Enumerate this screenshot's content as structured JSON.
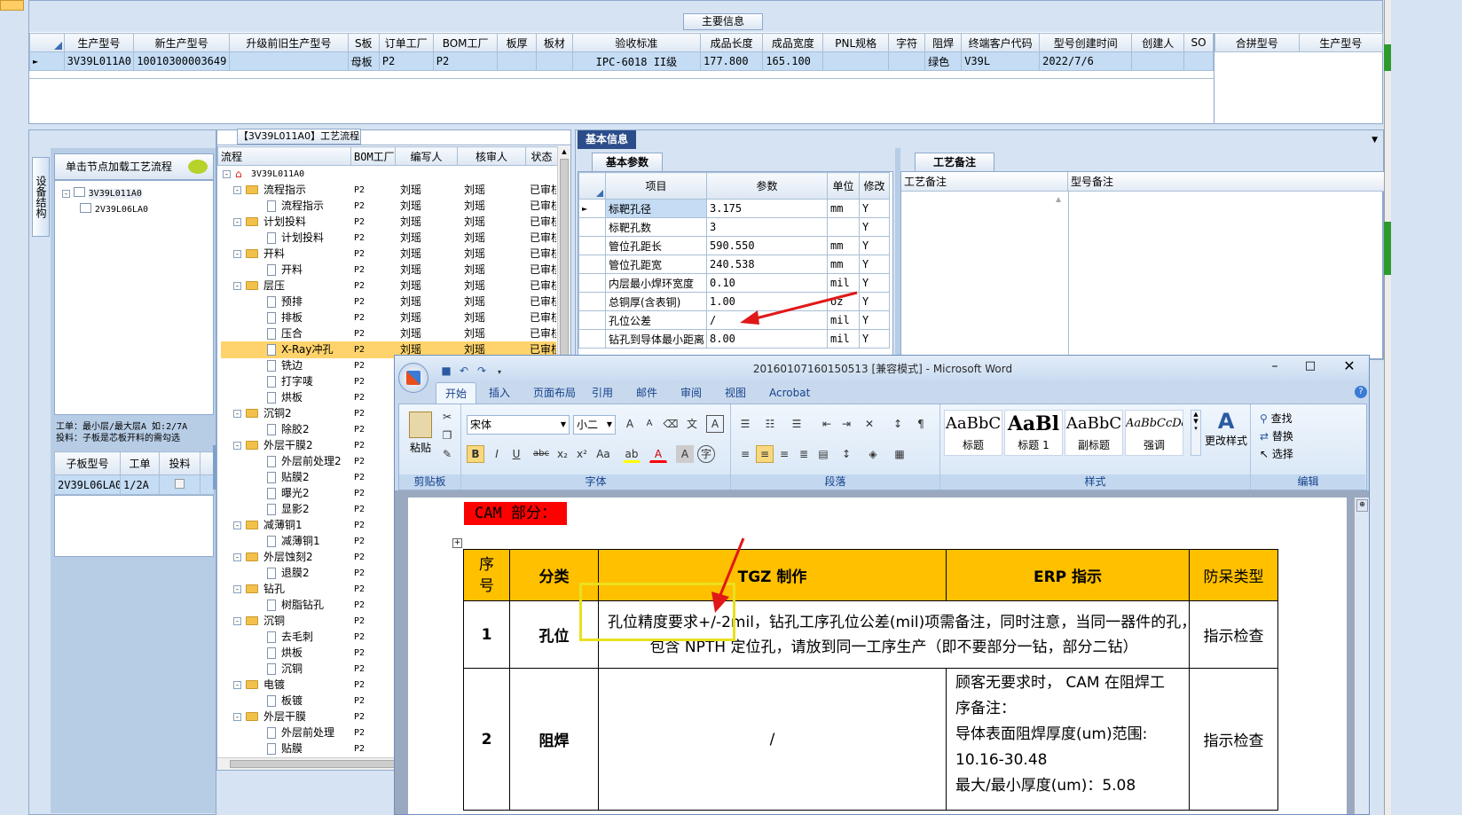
{
  "top_grid": {
    "title": "主要信息",
    "columns": [
      "生产型号",
      "新生产型号",
      "升级前旧生产型号",
      "S板",
      "订单工厂",
      "BOM工厂",
      "板厚",
      "板材",
      "验收标准",
      "成品长度",
      "成品宽度",
      "PNL规格",
      "字符",
      "阻焊",
      "终端客户代码",
      "型号创建时间",
      "创建人",
      "SO"
    ],
    "row": [
      "3V39L011A0",
      "10010300003649",
      "",
      "母板",
      "P2",
      "P2",
      "",
      "",
      "IPC-6018 II级",
      "177.800",
      "165.100",
      "",
      "",
      "绿色",
      "V39L",
      "2022/7/6",
      "",
      ""
    ],
    "right_columns": [
      "合拼型号",
      "生产型号"
    ]
  },
  "left_panel": {
    "vtab": "设备结构",
    "load_label": "单击节点加载工艺流程",
    "tree": [
      "3V39L011A0",
      "2V39L06LA0"
    ],
    "note": "工单：最小层/最大层A 如:2/7A\n投料：子板是芯板开料的需勾选",
    "sub_columns": [
      "子板型号",
      "工单",
      "投料"
    ],
    "sub_row": [
      "2V39L06LA0",
      "1/2A",
      ""
    ]
  },
  "flow": {
    "title": "【3V39L011A0】工艺流程",
    "columns": [
      "流程",
      "BOM工厂",
      "编写人",
      "核审人",
      "状态"
    ],
    "rows": [
      {
        "n": "3V39L011A0",
        "lvl": 0,
        "t": "root"
      },
      {
        "n": "流程指示",
        "lvl": 1,
        "t": "f",
        "b": "P2",
        "w": "刘瑶",
        "c": "刘瑶",
        "s": "已审核"
      },
      {
        "n": "流程指示",
        "lvl": 2,
        "t": "d",
        "b": "P2",
        "w": "刘瑶",
        "c": "刘瑶",
        "s": "已审核"
      },
      {
        "n": "计划投料",
        "lvl": 1,
        "t": "f",
        "b": "P2",
        "w": "刘瑶",
        "c": "刘瑶",
        "s": "已审核"
      },
      {
        "n": "计划投料",
        "lvl": 2,
        "t": "d",
        "b": "P2",
        "w": "刘瑶",
        "c": "刘瑶",
        "s": "已审核"
      },
      {
        "n": "开料",
        "lvl": 1,
        "t": "f",
        "b": "P2",
        "w": "刘瑶",
        "c": "刘瑶",
        "s": "已审核"
      },
      {
        "n": "开料",
        "lvl": 2,
        "t": "d",
        "b": "P2",
        "w": "刘瑶",
        "c": "刘瑶",
        "s": "已审核"
      },
      {
        "n": "层压",
        "lvl": 1,
        "t": "f",
        "b": "P2",
        "w": "刘瑶",
        "c": "刘瑶",
        "s": "已审核"
      },
      {
        "n": "预排",
        "lvl": 2,
        "t": "d",
        "b": "P2",
        "w": "刘瑶",
        "c": "刘瑶",
        "s": "已审核"
      },
      {
        "n": "排板",
        "lvl": 2,
        "t": "d",
        "b": "P2",
        "w": "刘瑶",
        "c": "刘瑶",
        "s": "已审核"
      },
      {
        "n": "压合",
        "lvl": 2,
        "t": "d",
        "b": "P2",
        "w": "刘瑶",
        "c": "刘瑶",
        "s": "已审核"
      },
      {
        "n": "X-Ray冲孔",
        "lvl": 2,
        "t": "d",
        "b": "P2",
        "w": "刘瑶",
        "c": "刘瑶",
        "s": "已审核",
        "sel": true
      },
      {
        "n": "铣边",
        "lvl": 2,
        "t": "d",
        "b": "P2"
      },
      {
        "n": "打字唛",
        "lvl": 2,
        "t": "d",
        "b": "P2"
      },
      {
        "n": "烘板",
        "lvl": 2,
        "t": "d",
        "b": "P2"
      },
      {
        "n": "沉铜2",
        "lvl": 1,
        "t": "f",
        "b": "P2"
      },
      {
        "n": "除胶2",
        "lvl": 2,
        "t": "d",
        "b": "P2"
      },
      {
        "n": "外层干膜2",
        "lvl": 1,
        "t": "f",
        "b": "P2"
      },
      {
        "n": "外层前处理2",
        "lvl": 2,
        "t": "d",
        "b": "P2"
      },
      {
        "n": "贴膜2",
        "lvl": 2,
        "t": "d",
        "b": "P2"
      },
      {
        "n": "曝光2",
        "lvl": 2,
        "t": "d",
        "b": "P2"
      },
      {
        "n": "显影2",
        "lvl": 2,
        "t": "d",
        "b": "P2"
      },
      {
        "n": "减薄铜1",
        "lvl": 1,
        "t": "f",
        "b": "P2"
      },
      {
        "n": "减薄铜1",
        "lvl": 2,
        "t": "d",
        "b": "P2"
      },
      {
        "n": "外层蚀刻2",
        "lvl": 1,
        "t": "f",
        "b": "P2"
      },
      {
        "n": "退膜2",
        "lvl": 2,
        "t": "d",
        "b": "P2"
      },
      {
        "n": "钻孔",
        "lvl": 1,
        "t": "f",
        "b": "P2"
      },
      {
        "n": "树脂钻孔",
        "lvl": 2,
        "t": "d",
        "b": "P2"
      },
      {
        "n": "沉铜",
        "lvl": 1,
        "t": "f",
        "b": "P2"
      },
      {
        "n": "去毛刺",
        "lvl": 2,
        "t": "d",
        "b": "P2"
      },
      {
        "n": "烘板",
        "lvl": 2,
        "t": "d",
        "b": "P2"
      },
      {
        "n": "沉铜",
        "lvl": 2,
        "t": "d",
        "b": "P2"
      },
      {
        "n": "电镀",
        "lvl": 1,
        "t": "f",
        "b": "P2"
      },
      {
        "n": "板镀",
        "lvl": 2,
        "t": "d",
        "b": "P2"
      },
      {
        "n": "外层干膜",
        "lvl": 1,
        "t": "f",
        "b": "P2"
      },
      {
        "n": "外层前处理",
        "lvl": 2,
        "t": "d",
        "b": "P2"
      },
      {
        "n": "贴膜",
        "lvl": 2,
        "t": "d",
        "b": "P2"
      }
    ]
  },
  "basic": {
    "tab": "基本信息",
    "sub_tab": "基本参数",
    "columns": [
      "项目",
      "参数",
      "单位",
      "修改"
    ],
    "rows": [
      [
        "标靶孔径",
        "3.175",
        "mm",
        "Y"
      ],
      [
        "标靶孔数",
        "3",
        "",
        "Y"
      ],
      [
        "管位孔距长",
        "590.550",
        "mm",
        "Y"
      ],
      [
        "管位孔距宽",
        "240.538",
        "mm",
        "Y"
      ],
      [
        "内层最小焊环宽度",
        "0.10",
        "mil",
        "Y"
      ],
      [
        "总铜厚(含表铜)",
        "1.00",
        "oz",
        "Y"
      ],
      [
        "孔位公差",
        "/",
        "mil",
        "Y"
      ],
      [
        "钻孔到导体最小距离",
        "8.00",
        "mil",
        "Y"
      ]
    ]
  },
  "remarks": {
    "tab": "工艺备注",
    "col1": "工艺备注",
    "col2": "型号备注"
  },
  "word": {
    "title": "20160107160150513 [兼容模式] - Microsoft Word",
    "tabs": [
      "开始",
      "插入",
      "页面布局",
      "引用",
      "邮件",
      "审阅",
      "视图",
      "Acrobat"
    ],
    "groups": {
      "clip": "剪贴板",
      "font": "字体",
      "para": "段落",
      "styles": "样式",
      "edit": "编辑"
    },
    "paste": "粘贴",
    "font_name": "宋体",
    "font_size": "小二",
    "styles": [
      {
        "s": "AaBbC",
        "l": "标题"
      },
      {
        "s": "AaBl",
        "l": "标题 1"
      },
      {
        "s": "AaBbC",
        "l": "副标题"
      },
      {
        "s": "AaBbCcDd",
        "l": "强调"
      }
    ],
    "change_style": "更改样式",
    "find": "查找",
    "replace": "替换",
    "select": "选择",
    "cam": "CAM 部分：",
    "table_head": [
      "序号",
      "分类",
      "TGZ 制作",
      "ERP 指示",
      "防呆类型"
    ],
    "r1": {
      "num": "1",
      "cat": "孔位",
      "text1": "孔位精度要求+/-2mil，钻孔工序孔位公差(mil)项需备注，同时注意，当同一器件的孔，",
      "text2": "包含 NPTH 定位孔，请放到同一工序生产（即不要部分一钻，部分二钻）",
      "type": "指示检查"
    },
    "r2": {
      "num": "2",
      "cat": "阻焊",
      "tgz": "/",
      "erp1": "顾客无要求时， CAM 在阻焊工",
      "erp2": "序备注：",
      "erp3": "导体表面阻焊厚度(um)范围:",
      "erp4": "10.16-30.48",
      "erp5": "最大/最小厚度(um)：5.08",
      "type": "指示检查"
    }
  },
  "colors": {
    "header_blue": "#d6e3f2",
    "selected_row": "#c4dcf4",
    "highlight": "#ffd36b",
    "word_red": "#ff0000",
    "table_gold": "#ffc000",
    "arrow": "#e01818",
    "callout": "#e8e020"
  }
}
